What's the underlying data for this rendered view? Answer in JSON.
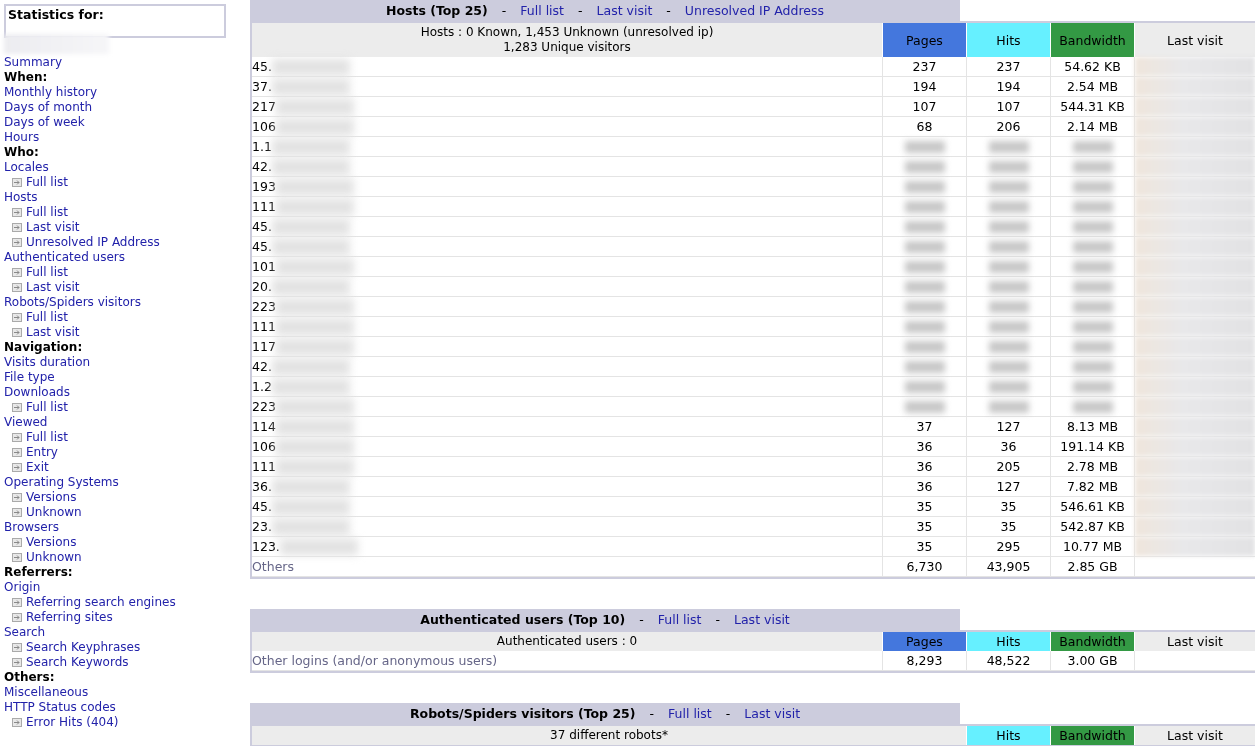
{
  "sidebar": {
    "title": "Statistics for:",
    "items": [
      {
        "kind": "link",
        "label": "Summary"
      },
      {
        "kind": "heading",
        "label": "When:"
      },
      {
        "kind": "link",
        "label": "Monthly history"
      },
      {
        "kind": "link",
        "label": "Days of month"
      },
      {
        "kind": "link",
        "label": "Days of week"
      },
      {
        "kind": "link",
        "label": "Hours"
      },
      {
        "kind": "heading",
        "label": "Who:"
      },
      {
        "kind": "link",
        "label": "Locales"
      },
      {
        "kind": "sub",
        "label": "Full list"
      },
      {
        "kind": "link",
        "label": "Hosts"
      },
      {
        "kind": "sub",
        "label": "Full list"
      },
      {
        "kind": "sub",
        "label": "Last visit"
      },
      {
        "kind": "sub",
        "label": "Unresolved IP Address"
      },
      {
        "kind": "link",
        "label": "Authenticated users"
      },
      {
        "kind": "sub",
        "label": "Full list"
      },
      {
        "kind": "sub",
        "label": "Last visit"
      },
      {
        "kind": "link",
        "label": "Robots/Spiders visitors"
      },
      {
        "kind": "sub",
        "label": "Full list"
      },
      {
        "kind": "sub",
        "label": "Last visit"
      },
      {
        "kind": "heading",
        "label": "Navigation:"
      },
      {
        "kind": "link",
        "label": "Visits duration"
      },
      {
        "kind": "link",
        "label": "File type"
      },
      {
        "kind": "link",
        "label": "Downloads"
      },
      {
        "kind": "sub",
        "label": "Full list"
      },
      {
        "kind": "link",
        "label": "Viewed"
      },
      {
        "kind": "sub",
        "label": "Full list"
      },
      {
        "kind": "sub",
        "label": "Entry"
      },
      {
        "kind": "sub",
        "label": "Exit"
      },
      {
        "kind": "link",
        "label": "Operating Systems"
      },
      {
        "kind": "sub",
        "label": "Versions"
      },
      {
        "kind": "sub",
        "label": "Unknown"
      },
      {
        "kind": "link",
        "label": "Browsers"
      },
      {
        "kind": "sub",
        "label": "Versions"
      },
      {
        "kind": "sub",
        "label": "Unknown"
      },
      {
        "kind": "heading",
        "label": "Referrers:"
      },
      {
        "kind": "link",
        "label": "Origin"
      },
      {
        "kind": "sub",
        "label": "Referring search engines"
      },
      {
        "kind": "sub",
        "label": "Referring sites"
      },
      {
        "kind": "link",
        "label": "Search"
      },
      {
        "kind": "sub",
        "label": "Search Keyphrases"
      },
      {
        "kind": "sub",
        "label": "Search Keywords"
      },
      {
        "kind": "heading",
        "label": "Others:"
      },
      {
        "kind": "link",
        "label": "Miscellaneous"
      },
      {
        "kind": "link",
        "label": "HTTP Status codes"
      },
      {
        "kind": "sub",
        "label": "Error Hits (404)"
      }
    ]
  },
  "sections": [
    {
      "title": "Hosts (Top 25)",
      "separator": "-",
      "links": [
        "Full list",
        "Last visit",
        "Unresolved IP Address"
      ],
      "summary": [
        "Hosts : 0 Known, 1,453 Unknown (unresolved ip)",
        "1,283 Unique visitors"
      ],
      "columns": [
        {
          "label": "Pages",
          "color": "#4477dd"
        },
        {
          "label": "Hits",
          "color": "#66f0ff"
        },
        {
          "label": "Bandwidth",
          "color": "#339944"
        },
        {
          "label": "Last visit",
          "color": "#ececec"
        }
      ],
      "rows": [
        {
          "label": "45.",
          "blurred": false,
          "values": [
            "237",
            "237",
            "54.62 KB"
          ]
        },
        {
          "label": "37.",
          "blurred": false,
          "values": [
            "194",
            "194",
            "2.54 MB"
          ]
        },
        {
          "label": "217",
          "blurred": false,
          "values": [
            "107",
            "107",
            "544.31 KB"
          ]
        },
        {
          "label": "106",
          "blurred": false,
          "values": [
            "68",
            "206",
            "2.14 MB"
          ]
        },
        {
          "label": "1.1",
          "blurred": true
        },
        {
          "label": "42.",
          "blurred": true
        },
        {
          "label": "193",
          "blurred": true
        },
        {
          "label": "111",
          "blurred": true
        },
        {
          "label": "45.",
          "blurred": true
        },
        {
          "label": "45.",
          "blurred": true
        },
        {
          "label": "101",
          "blurred": true
        },
        {
          "label": "20.",
          "blurred": true
        },
        {
          "label": "223",
          "blurred": true
        },
        {
          "label": "111",
          "blurred": true
        },
        {
          "label": "117",
          "blurred": true
        },
        {
          "label": "42.",
          "blurred": true
        },
        {
          "label": "1.2",
          "blurred": true
        },
        {
          "label": "223",
          "blurred": true
        },
        {
          "label": "114",
          "blurred": false,
          "values": [
            "37",
            "127",
            "8.13 MB"
          ]
        },
        {
          "label": "106",
          "blurred": false,
          "values": [
            "36",
            "36",
            "191.14 KB"
          ]
        },
        {
          "label": "111",
          "blurred": false,
          "values": [
            "36",
            "205",
            "2.78 MB"
          ]
        },
        {
          "label": "36.",
          "blurred": false,
          "values": [
            "36",
            "127",
            "7.82 MB"
          ]
        },
        {
          "label": "45.",
          "blurred": false,
          "values": [
            "35",
            "35",
            "546.61 KB"
          ]
        },
        {
          "label": "23.",
          "blurred": false,
          "values": [
            "35",
            "35",
            "542.87 KB"
          ]
        },
        {
          "label": "123.",
          "blurred": false,
          "values": [
            "35",
            "295",
            "10.77 MB"
          ]
        }
      ],
      "others": {
        "label": "Others",
        "values": [
          "6,730",
          "43,905",
          "2.85 GB"
        ]
      }
    },
    {
      "title": "Authenticated users (Top 10)",
      "separator": "-",
      "links": [
        "Full list",
        "Last visit"
      ],
      "summary": [
        "Authenticated users : 0"
      ],
      "columns": [
        {
          "label": "Pages",
          "color": "#4477dd"
        },
        {
          "label": "Hits",
          "color": "#66f0ff"
        },
        {
          "label": "Bandwidth",
          "color": "#339944"
        },
        {
          "label": "Last visit",
          "color": "#ececec"
        }
      ],
      "others": {
        "label": "Other logins (and/or anonymous users)",
        "values": [
          "8,293",
          "48,522",
          "3.00 GB"
        ]
      }
    },
    {
      "title": "Robots/Spiders visitors (Top 25)",
      "separator": "-",
      "links": [
        "Full list",
        "Last visit"
      ],
      "summary": [
        "37 different robots*"
      ],
      "columns": [
        {
          "label": "Hits",
          "color": "#66f0ff"
        },
        {
          "label": "Bandwidth",
          "color": "#339944"
        },
        {
          "label": "Last visit",
          "color": "#ececec"
        }
      ]
    }
  ]
}
